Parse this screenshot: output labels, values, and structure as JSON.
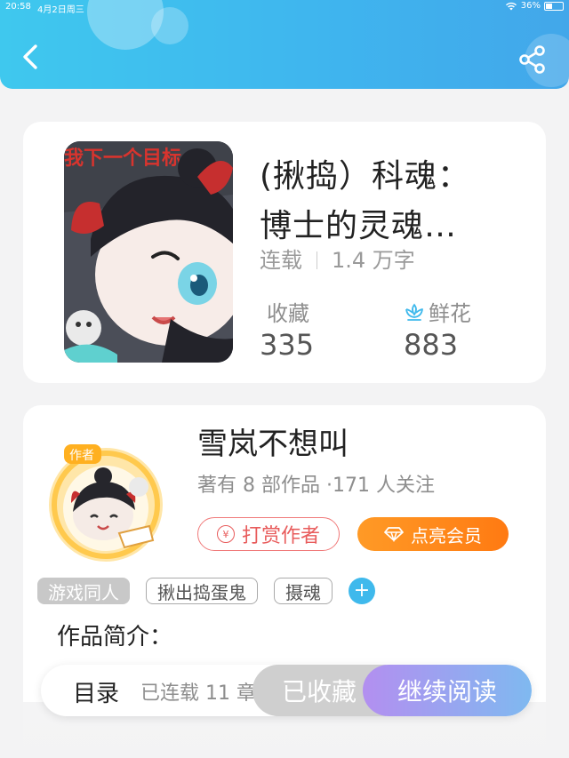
{
  "status_bar": {
    "time": "20:58",
    "date": "4月2日周三",
    "battery": "36%"
  },
  "header": {
    "back_icon": "chevron-left-icon",
    "share_icon": "share-icon",
    "color": "#3fb9ee"
  },
  "book": {
    "title_line1": "(揪捣）科魂：",
    "title_line2": "博士的灵魂…",
    "status": "连载",
    "word_count": "1.4 万字",
    "favorites_label": "收藏",
    "favorites_value": "335",
    "flowers_label": "鲜花",
    "flowers_value": "883",
    "flower_icon": "flower-icon",
    "cover_text": "我下一个目标"
  },
  "author": {
    "name": "雪岚不想叫",
    "info": "著有 8 部作品 ·171 人关注",
    "avatar_badge": "作者",
    "reward_label": "打赏作者",
    "vip_label": "点亮会员",
    "reward_color": "#e85c5c",
    "vip_color": "#ff8a1c"
  },
  "tags": [
    "游戏同人",
    "揪出捣蛋鬼",
    "摄魂"
  ],
  "intro": {
    "heading": "作品简介："
  },
  "bottom_bar": {
    "toc_label": "目录",
    "serial_info": "已连载 11 章",
    "saved_label": "已收藏",
    "read_label": "继续阅读"
  }
}
